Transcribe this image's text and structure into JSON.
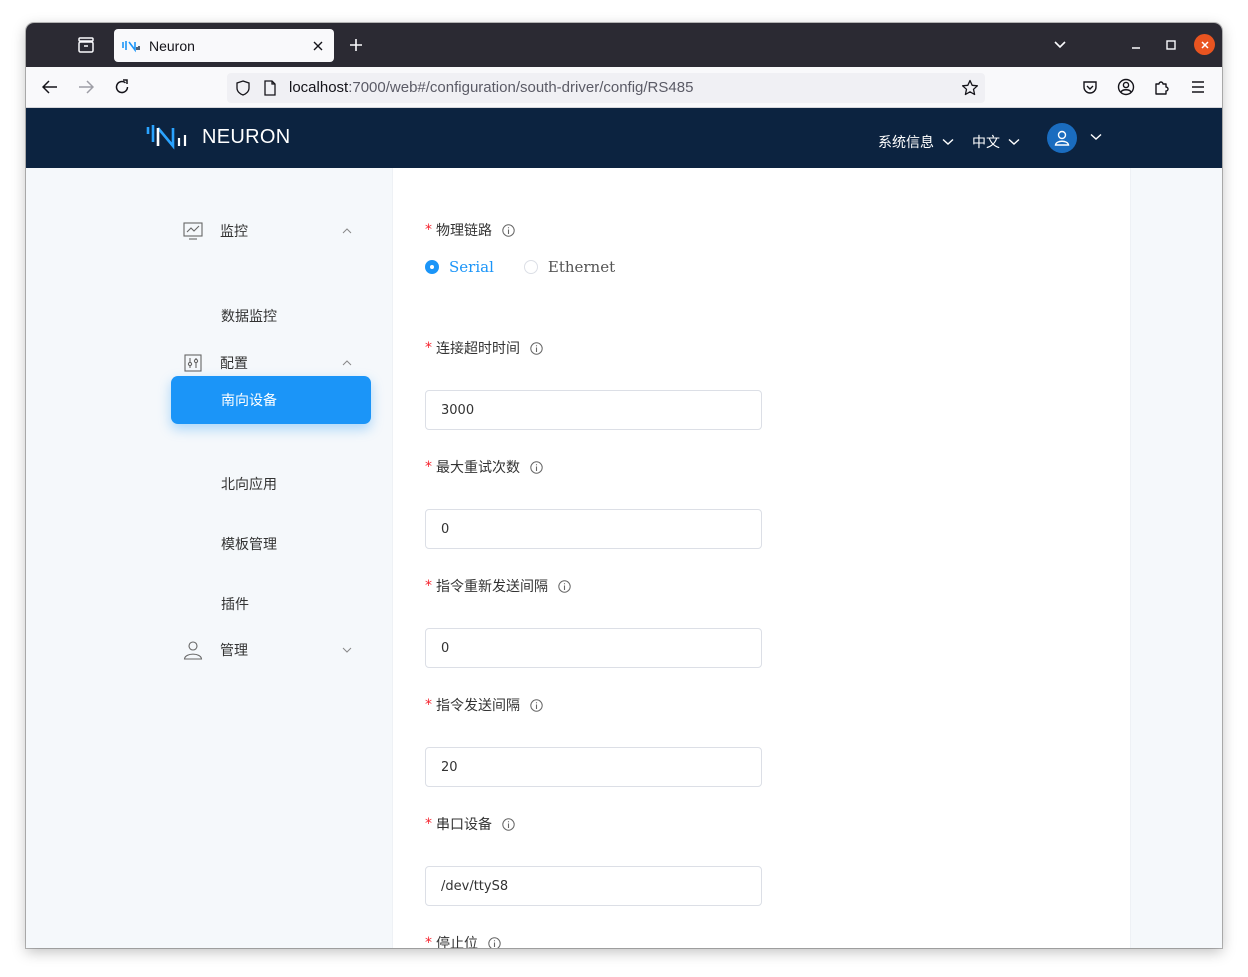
{
  "browser": {
    "tab_title": "Neuron",
    "url_host": "localhost",
    "url_path": ":7000/web#/configuration/south-driver/config/RS485"
  },
  "app": {
    "logo_text": "NEURON",
    "header_menu": {
      "system_info": "系统信息",
      "language": "中文"
    }
  },
  "sidebar": {
    "groups": [
      {
        "label": "监控",
        "icon": "monitor-icon",
        "expanded": true,
        "items": [
          "数据监控"
        ]
      },
      {
        "label": "配置",
        "icon": "config-icon",
        "expanded": true,
        "items": [
          "南向设备",
          "北向应用",
          "模板管理",
          "插件"
        ]
      },
      {
        "label": "管理",
        "icon": "user-icon",
        "expanded": false,
        "items": []
      }
    ],
    "active_item": "南向设备"
  },
  "form": {
    "physical_link": {
      "label": "物理链路",
      "options": [
        "Serial",
        "Ethernet"
      ],
      "selected": "Serial"
    },
    "fields": [
      {
        "label": "连接超时时间",
        "value": "3000"
      },
      {
        "label": "最大重试次数",
        "value": "0"
      },
      {
        "label": "指令重新发送间隔",
        "value": "0"
      },
      {
        "label": "指令发送间隔",
        "value": "20"
      },
      {
        "label": "串口设备",
        "value": "/dev/ttyS8"
      }
    ],
    "stop_bit_label": "停止位"
  },
  "colors": {
    "header_bg": "#0c2340",
    "accent": "#1b95f8",
    "required": "#f5222d"
  }
}
